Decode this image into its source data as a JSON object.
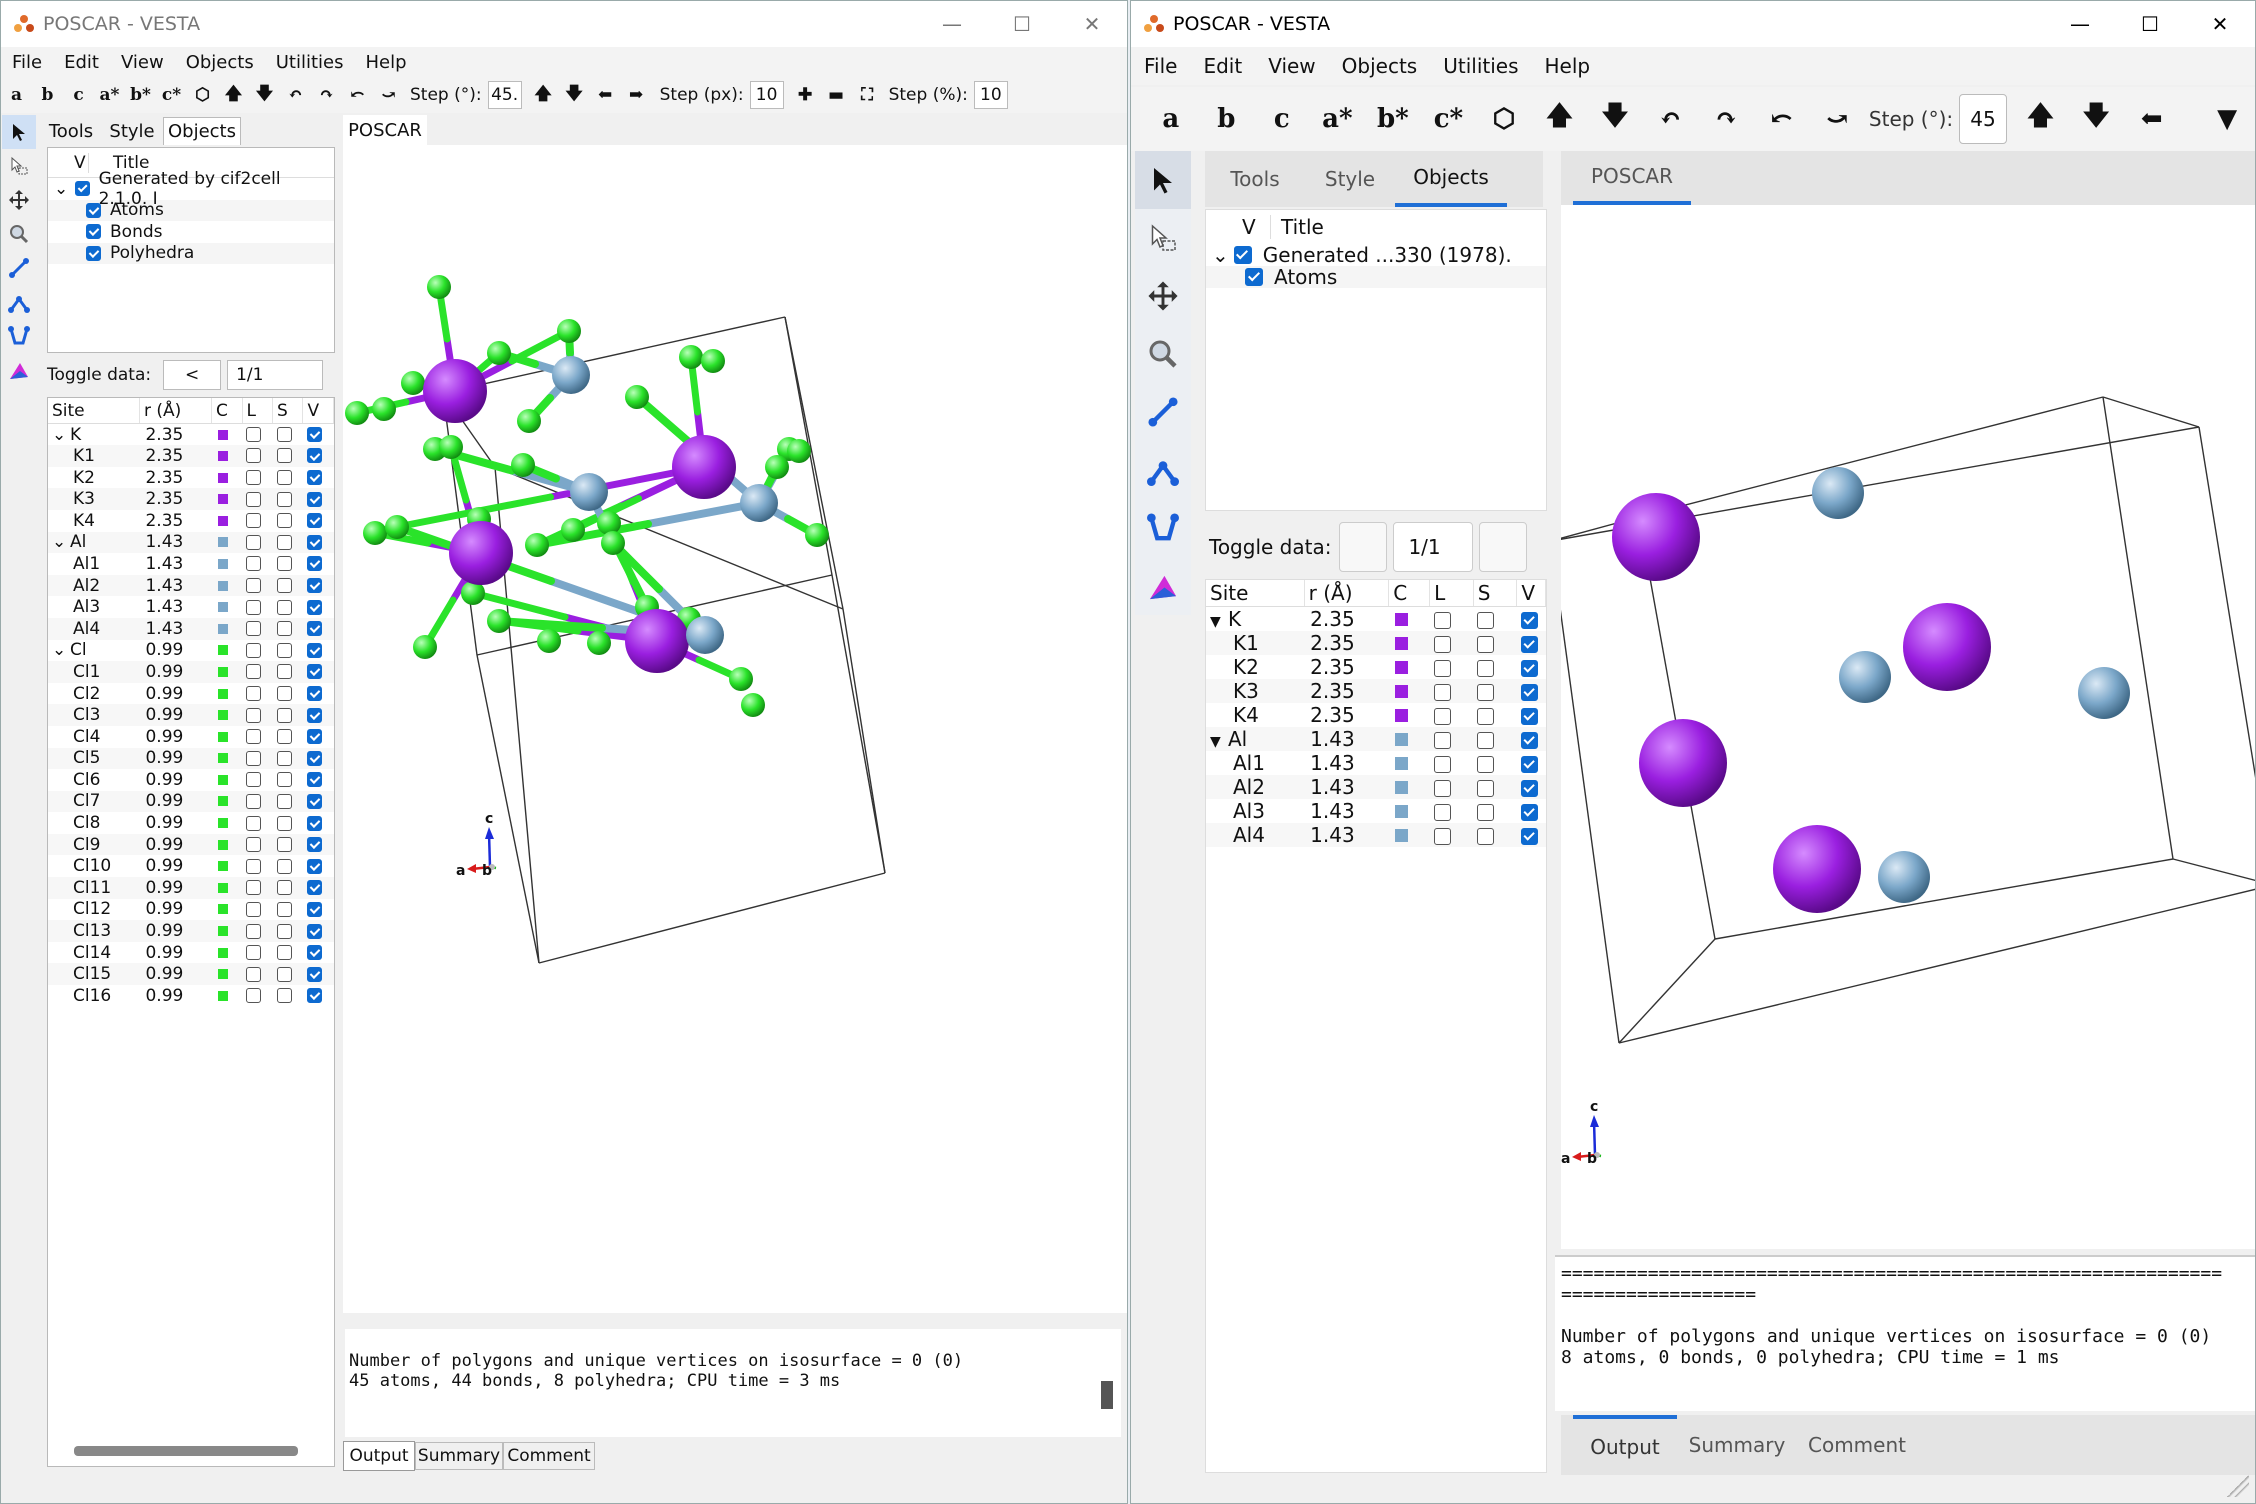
{
  "colors": {
    "K": "#9a1fe0",
    "Al": "#7ba7c9",
    "Cl": "#2ae32a",
    "check": "#0d6ad0"
  },
  "left": {
    "title": "POSCAR - VESTA",
    "menu": [
      "File",
      "Edit",
      "View",
      "Objects",
      "Utilities",
      "Help"
    ],
    "toolbar": {
      "buttons": [
        "a",
        "b",
        "c",
        "a*",
        "b*",
        "c*"
      ],
      "step_deg_label": "Step (°):",
      "step_deg": "45.",
      "step_px_label": "Step (px):",
      "step_px": "10",
      "step_pct_label": "Step (%):",
      "step_pct": "10"
    },
    "tabs": [
      "Tools",
      "Style",
      "Objects"
    ],
    "tree_header": {
      "v": "V",
      "title": "Title"
    },
    "tree": [
      {
        "label": "Generated by cif2cell 2.1.0. I",
        "level": 0
      },
      {
        "label": "Atoms",
        "level": 1
      },
      {
        "label": "Bonds",
        "level": 1
      },
      {
        "label": "Polyhedra",
        "level": 1
      }
    ],
    "toggle": {
      "label": "Toggle data:",
      "btn": "<",
      "value": "1/1"
    },
    "site_header": {
      "site": "Site",
      "r": "r (Å)",
      "c": "C",
      "l": "L",
      "s": "S",
      "v": "V"
    },
    "sites": [
      {
        "name": "K",
        "r": "2.35",
        "el": "K",
        "group": true
      },
      {
        "name": "K1",
        "r": "2.35",
        "el": "K"
      },
      {
        "name": "K2",
        "r": "2.35",
        "el": "K"
      },
      {
        "name": "K3",
        "r": "2.35",
        "el": "K"
      },
      {
        "name": "K4",
        "r": "2.35",
        "el": "K"
      },
      {
        "name": "Al",
        "r": "1.43",
        "el": "Al",
        "group": true
      },
      {
        "name": "Al1",
        "r": "1.43",
        "el": "Al"
      },
      {
        "name": "Al2",
        "r": "1.43",
        "el": "Al"
      },
      {
        "name": "Al3",
        "r": "1.43",
        "el": "Al"
      },
      {
        "name": "Al4",
        "r": "1.43",
        "el": "Al"
      },
      {
        "name": "Cl",
        "r": "0.99",
        "el": "Cl",
        "group": true
      },
      {
        "name": "Cl1",
        "r": "0.99",
        "el": "Cl"
      },
      {
        "name": "Cl2",
        "r": "0.99",
        "el": "Cl"
      },
      {
        "name": "Cl3",
        "r": "0.99",
        "el": "Cl"
      },
      {
        "name": "Cl4",
        "r": "0.99",
        "el": "Cl"
      },
      {
        "name": "Cl5",
        "r": "0.99",
        "el": "Cl"
      },
      {
        "name": "Cl6",
        "r": "0.99",
        "el": "Cl"
      },
      {
        "name": "Cl7",
        "r": "0.99",
        "el": "Cl"
      },
      {
        "name": "Cl8",
        "r": "0.99",
        "el": "Cl"
      },
      {
        "name": "Cl9",
        "r": "0.99",
        "el": "Cl"
      },
      {
        "name": "Cl10",
        "r": "0.99",
        "el": "Cl"
      },
      {
        "name": "Cl11",
        "r": "0.99",
        "el": "Cl"
      },
      {
        "name": "Cl12",
        "r": "0.99",
        "el": "Cl"
      },
      {
        "name": "Cl13",
        "r": "0.99",
        "el": "Cl"
      },
      {
        "name": "Cl14",
        "r": "0.99",
        "el": "Cl"
      },
      {
        "name": "Cl15",
        "r": "0.99",
        "el": "Cl"
      },
      {
        "name": "Cl16",
        "r": "0.99",
        "el": "Cl"
      }
    ],
    "view_tab": "POSCAR",
    "axes": {
      "a": "a",
      "b": "b",
      "c": "c"
    },
    "output": [
      "Number of polygons and unique vertices on isosurface = 0 (0)",
      "45 atoms, 44 bonds, 8 polyhedra; CPU time = 3 ms"
    ],
    "bottom_tabs": [
      "Output",
      "Summary",
      "Comment"
    ]
  },
  "right": {
    "title": "POSCAR - VESTA",
    "menu": [
      "File",
      "Edit",
      "View",
      "Objects",
      "Utilities",
      "Help"
    ],
    "toolbar": {
      "buttons": [
        "a",
        "b",
        "c",
        "a*",
        "b*",
        "c*"
      ],
      "step_deg_label": "Step (°):",
      "step_deg": "45"
    },
    "tabs": [
      "Tools",
      "Style",
      "Objects"
    ],
    "tree_header": {
      "v": "V",
      "title": "Title"
    },
    "tree": [
      {
        "label": "Generated ...330 (1978).",
        "level": 0
      },
      {
        "label": "Atoms",
        "level": 1
      }
    ],
    "toggle": {
      "label": "Toggle data:",
      "value": "1/1"
    },
    "site_header": {
      "site": "Site",
      "r": "r (Å)",
      "c": "C",
      "l": "L",
      "s": "S",
      "v": "V"
    },
    "sites": [
      {
        "name": "K",
        "r": "2.35",
        "el": "K",
        "group": true
      },
      {
        "name": "K1",
        "r": "2.35",
        "el": "K"
      },
      {
        "name": "K2",
        "r": "2.35",
        "el": "K"
      },
      {
        "name": "K3",
        "r": "2.35",
        "el": "K"
      },
      {
        "name": "K4",
        "r": "2.35",
        "el": "K"
      },
      {
        "name": "Al",
        "r": "1.43",
        "el": "Al",
        "group": true
      },
      {
        "name": "Al1",
        "r": "1.43",
        "el": "Al"
      },
      {
        "name": "Al2",
        "r": "1.43",
        "el": "Al"
      },
      {
        "name": "Al3",
        "r": "1.43",
        "el": "Al"
      },
      {
        "name": "Al4",
        "r": "1.43",
        "el": "Al"
      }
    ],
    "view_tab": "POSCAR",
    "axes": {
      "a": "a",
      "b": "b",
      "c": "c"
    },
    "output": [
      "=============================================================",
      "==================",
      "",
      "Number of polygons and unique vertices on isosurface = 0 (0)",
      "8 atoms, 0 bonds, 0 polyhedra; CPU time = 1 ms"
    ],
    "bottom_tabs": [
      "Output",
      "Summary",
      "Comment"
    ]
  }
}
